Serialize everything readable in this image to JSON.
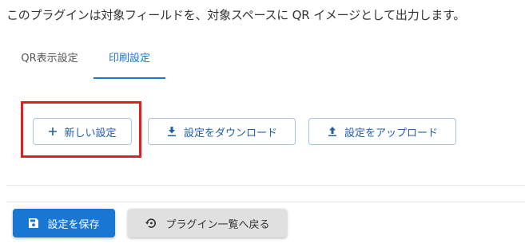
{
  "description": "このプラグインは対象フィールドを、対象スペースに QR イメージとして出力します。",
  "tabs": [
    {
      "label": "QR表示設定",
      "active": false
    },
    {
      "label": "印刷設定",
      "active": true
    }
  ],
  "actions": {
    "new_label": "新しい設定",
    "download_label": "設定をダウンロード",
    "upload_label": "設定をアップロード"
  },
  "footer": {
    "save_label": "設定を保存",
    "back_label": "プラグイン一覧へ戻る"
  },
  "icons": {
    "new": "plus-icon",
    "download": "download-icon",
    "upload": "upload-icon",
    "save": "save-icon",
    "back": "history-icon"
  },
  "colors": {
    "primary": "#1976d2",
    "highlight": "#e02020",
    "secondary_bg": "#e0e0e0"
  }
}
